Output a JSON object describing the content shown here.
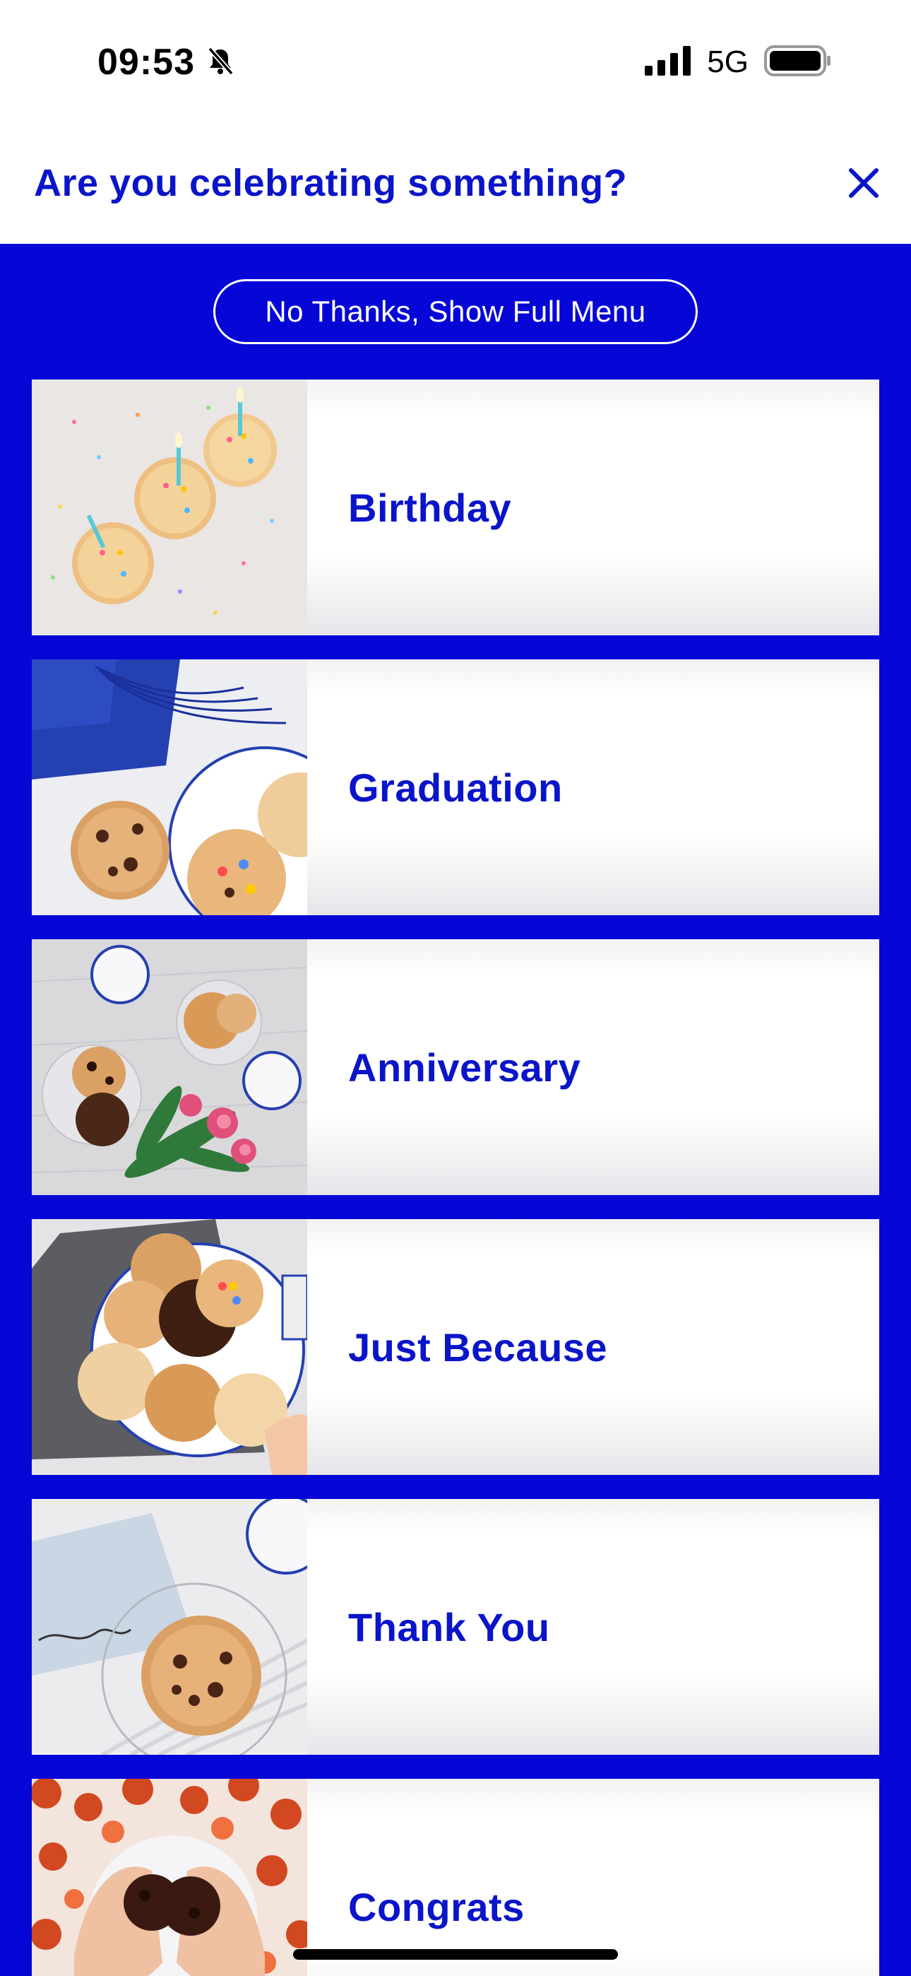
{
  "status_bar": {
    "time": "09:53",
    "network": "5G"
  },
  "header": {
    "title": "Are you celebrating something?"
  },
  "actions": {
    "skip_label": "No Thanks, Show Full Menu"
  },
  "occasions": [
    {
      "label": "Birthday"
    },
    {
      "label": "Graduation"
    },
    {
      "label": "Anniversary"
    },
    {
      "label": "Just Because"
    },
    {
      "label": "Thank You"
    },
    {
      "label": "Congrats"
    }
  ],
  "colors": {
    "brand_blue": "#0606d6",
    "title_blue": "#0a14c8",
    "card_white": "#ffffff"
  }
}
